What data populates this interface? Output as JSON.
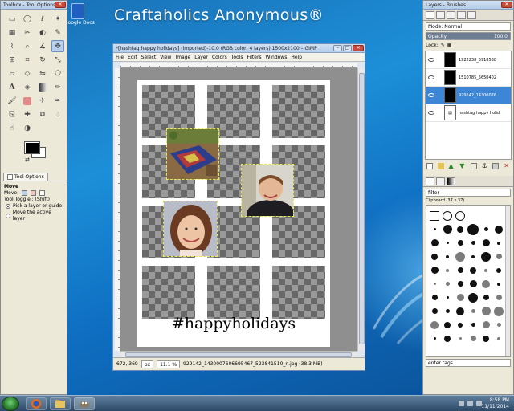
{
  "desktop": {
    "watermark": "Craftaholics Anonymous®",
    "icon_label": "Google Docs"
  },
  "toolbox": {
    "title": "Toolbox - Tool Options",
    "tool_icons": [
      "rect-select",
      "ellipse-select",
      "lasso",
      "fuzzy-select",
      "color-select",
      "scissors",
      "foreground-select",
      "paths",
      "color-picker",
      "zoom",
      "measure",
      "move",
      "align",
      "crop",
      "rotate",
      "scale",
      "shear",
      "perspective",
      "flip",
      "cage",
      "text",
      "bucket-fill",
      "blend",
      "pencil",
      "paintbrush",
      "eraser",
      "airbrush",
      "ink",
      "clone",
      "heal",
      "perspective-clone",
      "blur",
      "smudge",
      "dodge"
    ],
    "tab_label": "Tool Options",
    "options_title": "Move",
    "move_label": "Move:",
    "toggle_label": "Tool Toggle : (Shift)",
    "radio_pick": "Pick a layer or guide",
    "radio_move": "Move the active layer"
  },
  "image_window": {
    "title": "*[hashtag happy holidays] (imported)-10.0 (RGB color, 4 layers) 1500x2100 – GIMP",
    "menu": [
      "File",
      "Edit",
      "Select",
      "View",
      "Image",
      "Layer",
      "Colors",
      "Tools",
      "Filters",
      "Windows",
      "Help"
    ],
    "status": {
      "coords": "672, 369",
      "units": "px",
      "zoom": "11.1 %",
      "file": "929142_1430007606695467_523841510_n.jpg (38.3 MB)"
    },
    "canvas_text": "#happyholidays"
  },
  "layers": {
    "title": "Layers - Brushes",
    "mode_label": "Mode: Normal",
    "opacity_label": "Opacity",
    "opacity_value": "100.0",
    "lock_label": "Lock:",
    "items": [
      {
        "name": "1922238_5918538",
        "selected": false
      },
      {
        "name": "1510785_5650402",
        "selected": false
      },
      {
        "name": "929142_14300076",
        "selected": true
      },
      {
        "name": "hashtag happy holid",
        "selected": false
      }
    ],
    "filter_label": "filter",
    "brush_name": "Clipboard (37 x 37)",
    "tags_label": "enter tags"
  },
  "taskbar": {
    "time": "8:58 PM",
    "date": "11/11/2014"
  },
  "colors": {
    "accent": "#3d86d6",
    "desktop": "#1c8fd8",
    "foreground": "#000000",
    "background": "#ffffff"
  }
}
